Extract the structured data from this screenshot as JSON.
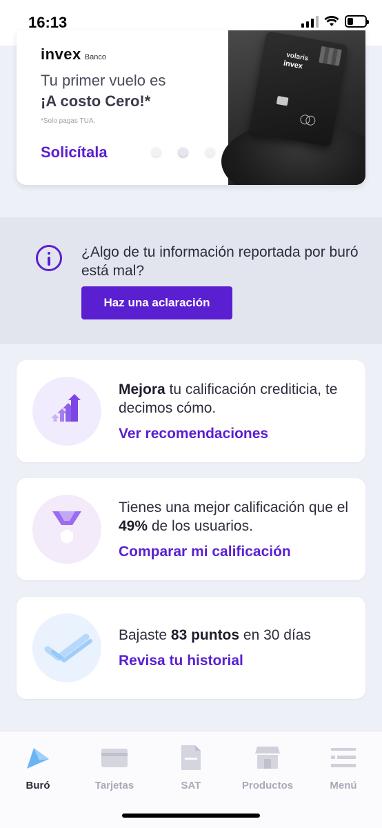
{
  "status_bar": {
    "time": "16:13",
    "battery_level": 0.35
  },
  "promo": {
    "logo_main": "invex",
    "logo_sub": "Banco",
    "line1": "Tu primer vuelo es",
    "line2": "¡A costo Cero!*",
    "note": "*Solo pagas TUA.",
    "cta": "Solicítala",
    "card_brand": "volaris",
    "card_brand2": "invex",
    "active_dot": 2,
    "dot_count": 3
  },
  "report": {
    "question": "¿Algo de tu información reportada por buró está mal?",
    "button_label": "Haz una aclaración"
  },
  "cards": {
    "improve": {
      "bold": "Mejora",
      "rest": " tu calificación crediticia, te decimos cómo.",
      "link": "Ver recomendaciones"
    },
    "compare": {
      "pre": "Tienes una mejor calificación que el ",
      "bold": "49%",
      "post": " de los usuarios.",
      "link": "Comparar mi calificación"
    },
    "history": {
      "pre": "Bajaste ",
      "bold": "83 puntos",
      "post": " en 30 días",
      "link": "Revisa tu historial"
    }
  },
  "nav": {
    "items": [
      {
        "label": "Buró",
        "icon": "buro-icon",
        "active": true
      },
      {
        "label": "Tarjetas",
        "icon": "card-icon",
        "active": false
      },
      {
        "label": "SAT",
        "icon": "document-icon",
        "active": false
      },
      {
        "label": "Productos",
        "icon": "store-icon",
        "active": false
      },
      {
        "label": "Menú",
        "icon": "menu-icon",
        "active": false
      }
    ]
  },
  "colors": {
    "accent": "#5a1fd1",
    "background": "#eef0f7",
    "nav_inactive": "#a9aab9",
    "nav_active": "#2b2b3b"
  }
}
